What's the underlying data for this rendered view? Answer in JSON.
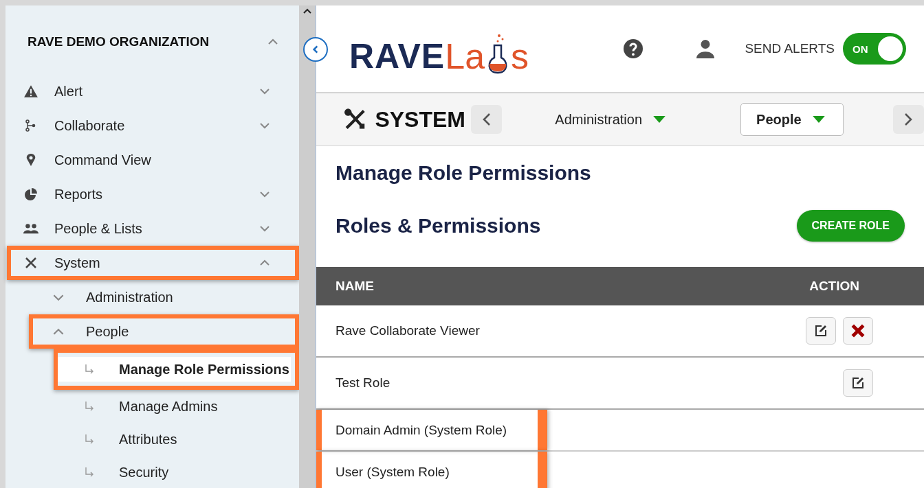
{
  "sidebar": {
    "title": "RAVE DEMO ORGANIZATION",
    "expanded": true,
    "items": [
      {
        "label": "Alert",
        "expanded": false,
        "selected": false,
        "highlighted": false
      },
      {
        "label": "Collaborate",
        "expanded": false,
        "selected": false,
        "highlighted": false
      },
      {
        "label": "Command View",
        "selected": false,
        "highlighted": false
      },
      {
        "label": "Reports",
        "expanded": false,
        "selected": false,
        "highlighted": false
      },
      {
        "label": "People & Lists",
        "expanded": false,
        "selected": false,
        "highlighted": false
      },
      {
        "label": "System",
        "expanded": true,
        "selected": false,
        "highlighted": true,
        "children": [
          {
            "label": "Administration",
            "expanded": false,
            "selected": false,
            "highlighted": false
          },
          {
            "label": "People",
            "expanded": true,
            "selected": false,
            "highlighted": true,
            "children": [
              {
                "label": "Manage Role Permissions",
                "selected": true,
                "highlighted": true
              },
              {
                "label": "Manage Admins",
                "selected": false,
                "highlighted": false
              },
              {
                "label": "Attributes",
                "selected": false,
                "highlighted": false
              },
              {
                "label": "Security",
                "selected": false,
                "highlighted": false
              }
            ]
          }
        ]
      }
    ]
  },
  "header": {
    "logo": {
      "part_1": "RAVE",
      "part_2": "La",
      "part_3": "s"
    },
    "send_alerts": {
      "label": "SEND ALERTS",
      "on": true,
      "text": "ON"
    }
  },
  "section_bar": {
    "title": "SYSTEM",
    "dropdowns": [
      {
        "label": "Administration",
        "selected": false
      },
      {
        "label": "People",
        "selected": true
      }
    ]
  },
  "page_title": "Manage Role Permissions",
  "section_title": "Roles & Permissions",
  "create_button": "CREATE ROLE",
  "table": {
    "columns": [
      "NAME",
      "ACTION"
    ],
    "rows": [
      {
        "name": "Rave Collaborate Viewer",
        "editable": true,
        "deletable": true,
        "highlighted": false
      },
      {
        "name": "Test Role",
        "editable": true,
        "deletable": false,
        "highlighted": false
      },
      {
        "name": "Domain Admin (System Role)",
        "editable": false,
        "deletable": false,
        "highlighted": true
      },
      {
        "name": "User (System Role)",
        "editable": false,
        "deletable": false,
        "highlighted": true
      }
    ]
  }
}
